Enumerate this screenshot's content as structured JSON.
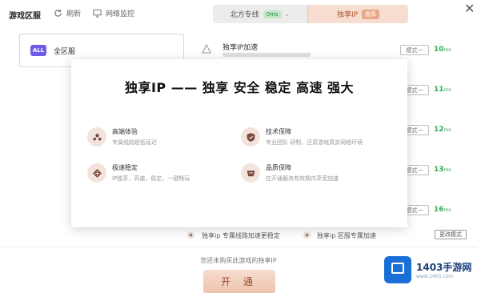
{
  "header": {
    "title": "游戏区服",
    "refresh_label": "刷新",
    "monitor_label": "网络监控"
  },
  "modes": {
    "north_label": "北方专线",
    "north_badge": "0ms",
    "exclusive_label": "独享IP",
    "exclusive_tag": "推荐"
  },
  "region": {
    "badge": "ALL",
    "label": "全区服"
  },
  "nodes": [
    {
      "name": "独享IP加速",
      "mode": "模式一",
      "latency": "10",
      "unit": "ms"
    },
    {
      "name": "",
      "mode": "模式一",
      "latency": "11",
      "unit": "ms"
    },
    {
      "name": "",
      "mode": "模式一",
      "latency": "12",
      "unit": "ms"
    },
    {
      "name": "",
      "mode": "模式一",
      "latency": "13",
      "unit": "ms"
    },
    {
      "name": "",
      "mode": "模式一",
      "latency": "16",
      "unit": "ms"
    }
  ],
  "overlay": {
    "title": "独享IP —— 独享 安全 稳定 高速 强大",
    "features": [
      {
        "title": "高端体验",
        "desc": "专属线路超低延迟"
      },
      {
        "title": "技术保障",
        "desc": "专业团队 研制，还原游戏真实网络环境"
      },
      {
        "title": "极速稳定",
        "desc": "IP独享，高速，稳定，一键畅玩"
      },
      {
        "title": "品质保障",
        "desc": "在开通服务有效期内享受加速"
      }
    ]
  },
  "bottom_strip": {
    "text1": "独享ip 专属线路加速更稳定",
    "text2": "独享ip 区服专属加速",
    "button": "更改模式"
  },
  "footer": {
    "prompt": "您还未购买此游戏的独享IP",
    "open_button": "开 通"
  },
  "watermark": {
    "name": "1403手游网",
    "url": "www.1403.com"
  },
  "colors": {
    "accent": "#f7ddd0",
    "accent_text": "#a0492a",
    "latency_green": "#3aaa5a",
    "all_badge": "#6c5ce7"
  }
}
